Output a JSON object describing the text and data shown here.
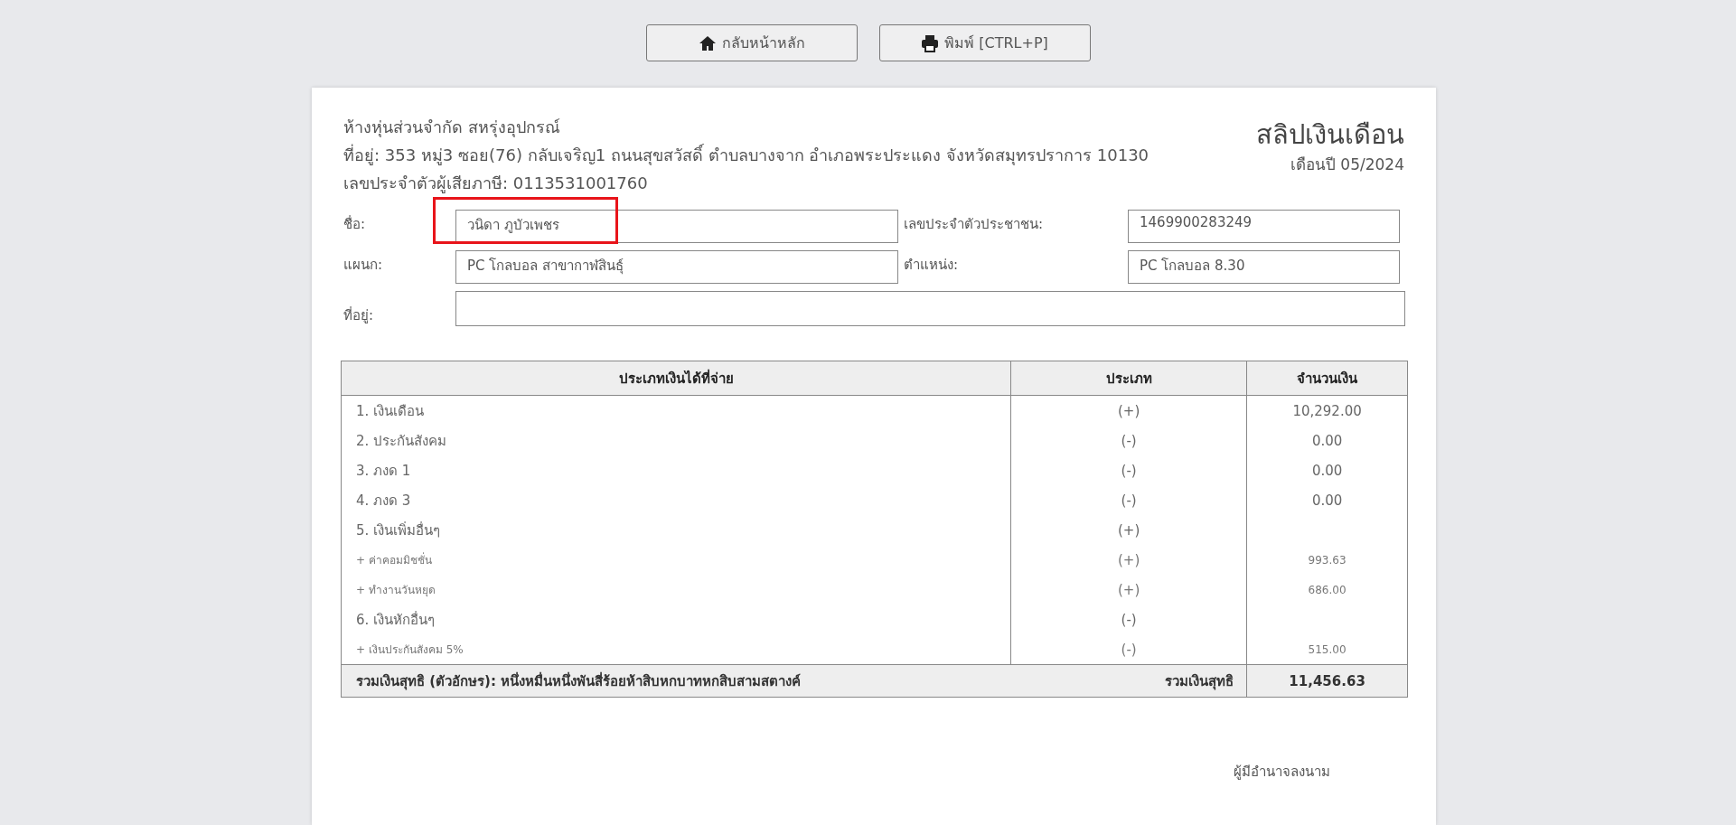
{
  "toolbar": {
    "buttons": [
      {
        "kind": "home",
        "label": "กลับหน้าหลัก"
      },
      {
        "kind": "print",
        "label": "พิมพ์ [CTRL+P]"
      }
    ]
  },
  "company": {
    "name": "ห้างหุ่นส่วนจำกัด สหรุ่งอุปกรณ์",
    "address": "ที่อยู่: 353 หมู่3 ซอย(76) กลับเจริญ1 ถนนสุขสวัสดิ์ ตำบลบางจาก อำเภอพระประแดง จังหวัดสมุทรปราการ 10130",
    "tax_id": "เลขประจำตัวผู้เสียภาษี: 0113531001760"
  },
  "slip": {
    "title": "สลิปเงินเดือน",
    "period": "เดือนปี 05/2024"
  },
  "employee": [
    {
      "label": "ชื่อ:",
      "value": "วนิดา ภูบัวเพชร",
      "highlighted": true
    },
    {
      "label": "เลขประจำตัวประชาชน:",
      "value": "1469900283249",
      "highlighted": false
    },
    {
      "label": "แผนก:",
      "value": "PC โกลบอล สาขากาฬสินธุ์",
      "highlighted": false
    },
    {
      "label": "ตำแหน่ง:",
      "value": "PC โกลบอล 8.30",
      "highlighted": false
    },
    {
      "label": "ที่อยู่:",
      "wide": true,
      "highlighted": false
    }
  ],
  "table": {
    "columns": [
      "ประเภทเงินได้ที่จ่าย",
      "ประเภท",
      "จำนวนเงิน"
    ],
    "rows": [
      {
        "kind": "main",
        "item": "1. เงินเดือน",
        "sign": "(+)",
        "amount": "10,292.00"
      },
      {
        "kind": "main",
        "item": "2. ประกันสังคม",
        "sign": "(-)",
        "amount": "0.00"
      },
      {
        "kind": "main",
        "item": "3. ภงด 1",
        "sign": "(-)",
        "amount": "0.00"
      },
      {
        "kind": "main",
        "item": "4. ภงด 3",
        "sign": "(-)",
        "amount": "0.00"
      },
      {
        "kind": "main",
        "item": "5. เงินเพิ่มอื่นๆ",
        "sign": "(+)"
      },
      {
        "kind": "sub",
        "item": "+ ค่าคอมมิชชั่น",
        "sign": "(+)",
        "amount": "993.63"
      },
      {
        "kind": "sub",
        "item": "+ ทำงานวันหยุด",
        "sign": "(+)",
        "amount": "686.00"
      },
      {
        "kind": "main",
        "item": "6. เงินหักอื่นๆ",
        "sign": "(-)"
      },
      {
        "kind": "sub",
        "item": "+ เงินประกันสังคม 5%",
        "sign": "(-)",
        "amount": "515.00"
      }
    ],
    "footer": {
      "words": "รวมเงินสุทธิ (ตัวอักษร): หนึ่งหมื่นหนึ่งพันสี่ร้อยห้าสิบหกบาทหกสิบสามสตางค์",
      "label": "รวมเงินสุทธิ",
      "total": "11,456.63"
    }
  },
  "signature": "ผู้มีอำนาจลงนาม"
}
